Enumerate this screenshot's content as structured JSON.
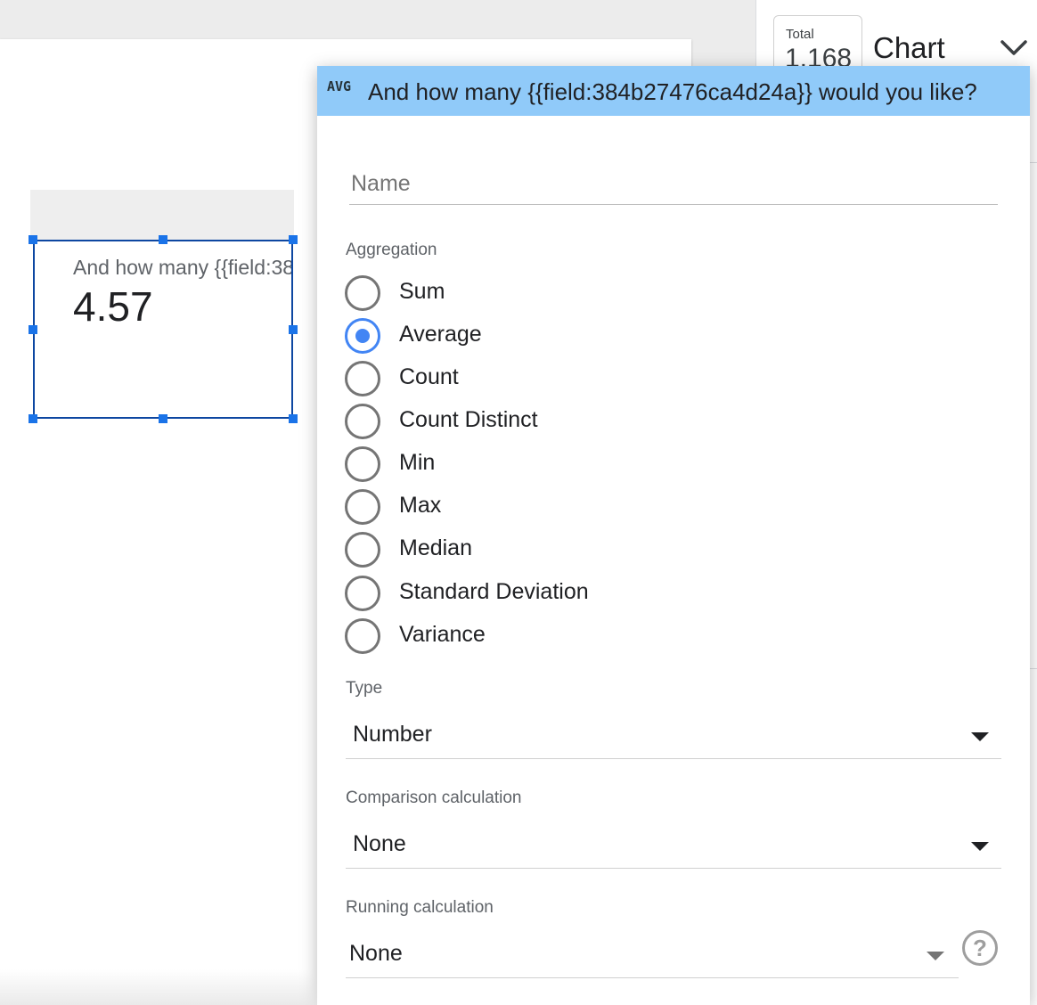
{
  "scorecard": {
    "label": "And how many {{field:384",
    "value": "4.57"
  },
  "right_panel": {
    "total_label": "Total",
    "total_value": "1,168",
    "title": "Chart",
    "chevron_icon": "chevron-down-icon"
  },
  "editor": {
    "badge": "AVG",
    "title": "And how many {{field:384b27476ca4d24a}} would you like?",
    "header_color": "#90caf9",
    "name_placeholder": "Name",
    "name_value": "",
    "aggregation_label": "Aggregation",
    "aggregation_options": [
      "Sum",
      "Average",
      "Count",
      "Count Distinct",
      "Min",
      "Max",
      "Median",
      "Standard Deviation",
      "Variance"
    ],
    "aggregation_selected": "Average",
    "type_label": "Type",
    "type_value": "Number",
    "comparison_label": "Comparison calculation",
    "comparison_value": "None",
    "running_label": "Running calculation",
    "running_value": "None",
    "help_icon": "help-circle-icon"
  },
  "colors": {
    "selection_blue": "#1a73e8",
    "radio_checked": "#4285f4"
  }
}
